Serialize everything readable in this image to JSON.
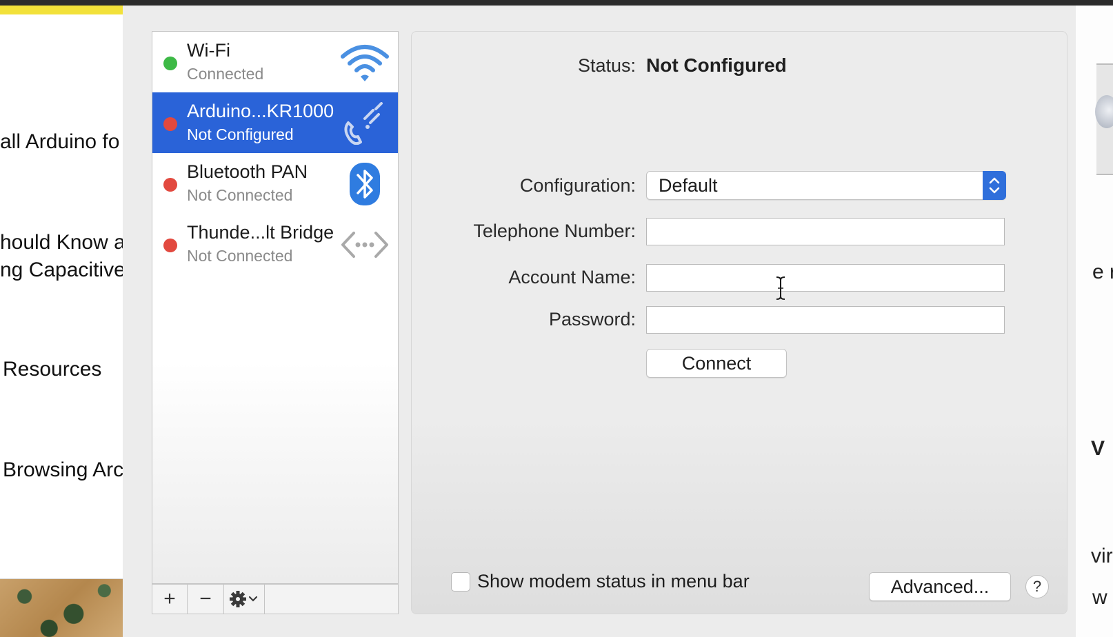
{
  "background": {
    "left_lines": [
      "all Arduino fo",
      "hould Know a",
      "ng Capacitive",
      "Resources",
      "Browsing Arc"
    ],
    "right_fragments": [
      "e r",
      "V",
      "vir",
      "w"
    ]
  },
  "sidebar": {
    "services": [
      {
        "name": "Wi-Fi",
        "status": "Connected",
        "status_color": "#3db946",
        "icon": "wifi-icon",
        "selected": false
      },
      {
        "name": "Arduino...KR1000",
        "status": "Not Configured",
        "status_color": "#e2493f",
        "icon": "phone-icon",
        "selected": true
      },
      {
        "name": "Bluetooth PAN",
        "status": "Not Connected",
        "status_color": "#e2493f",
        "icon": "bluetooth-icon",
        "selected": false
      },
      {
        "name": "Thunde...lt Bridge",
        "status": "Not Connected",
        "status_color": "#e2493f",
        "icon": "thunderbolt-bridge-icon",
        "selected": false
      }
    ],
    "toolbar": {
      "add": "+",
      "remove": "−",
      "gear_icon": "gear-icon"
    }
  },
  "detail": {
    "status_label": "Status:",
    "status_value": "Not Configured",
    "configuration_label": "Configuration:",
    "configuration_value": "Default",
    "telephone_label": "Telephone Number:",
    "telephone_value": "",
    "account_label": "Account Name:",
    "account_value": "",
    "password_label": "Password:",
    "password_value": "",
    "connect_button": "Connect",
    "show_modem_label": "Show modem status in menu bar",
    "show_modem_checked": false,
    "advanced_button": "Advanced...",
    "help_button": "?"
  },
  "colors": {
    "accent": "#2a63d8",
    "connected": "#3db946",
    "disconnected": "#e2493f"
  }
}
